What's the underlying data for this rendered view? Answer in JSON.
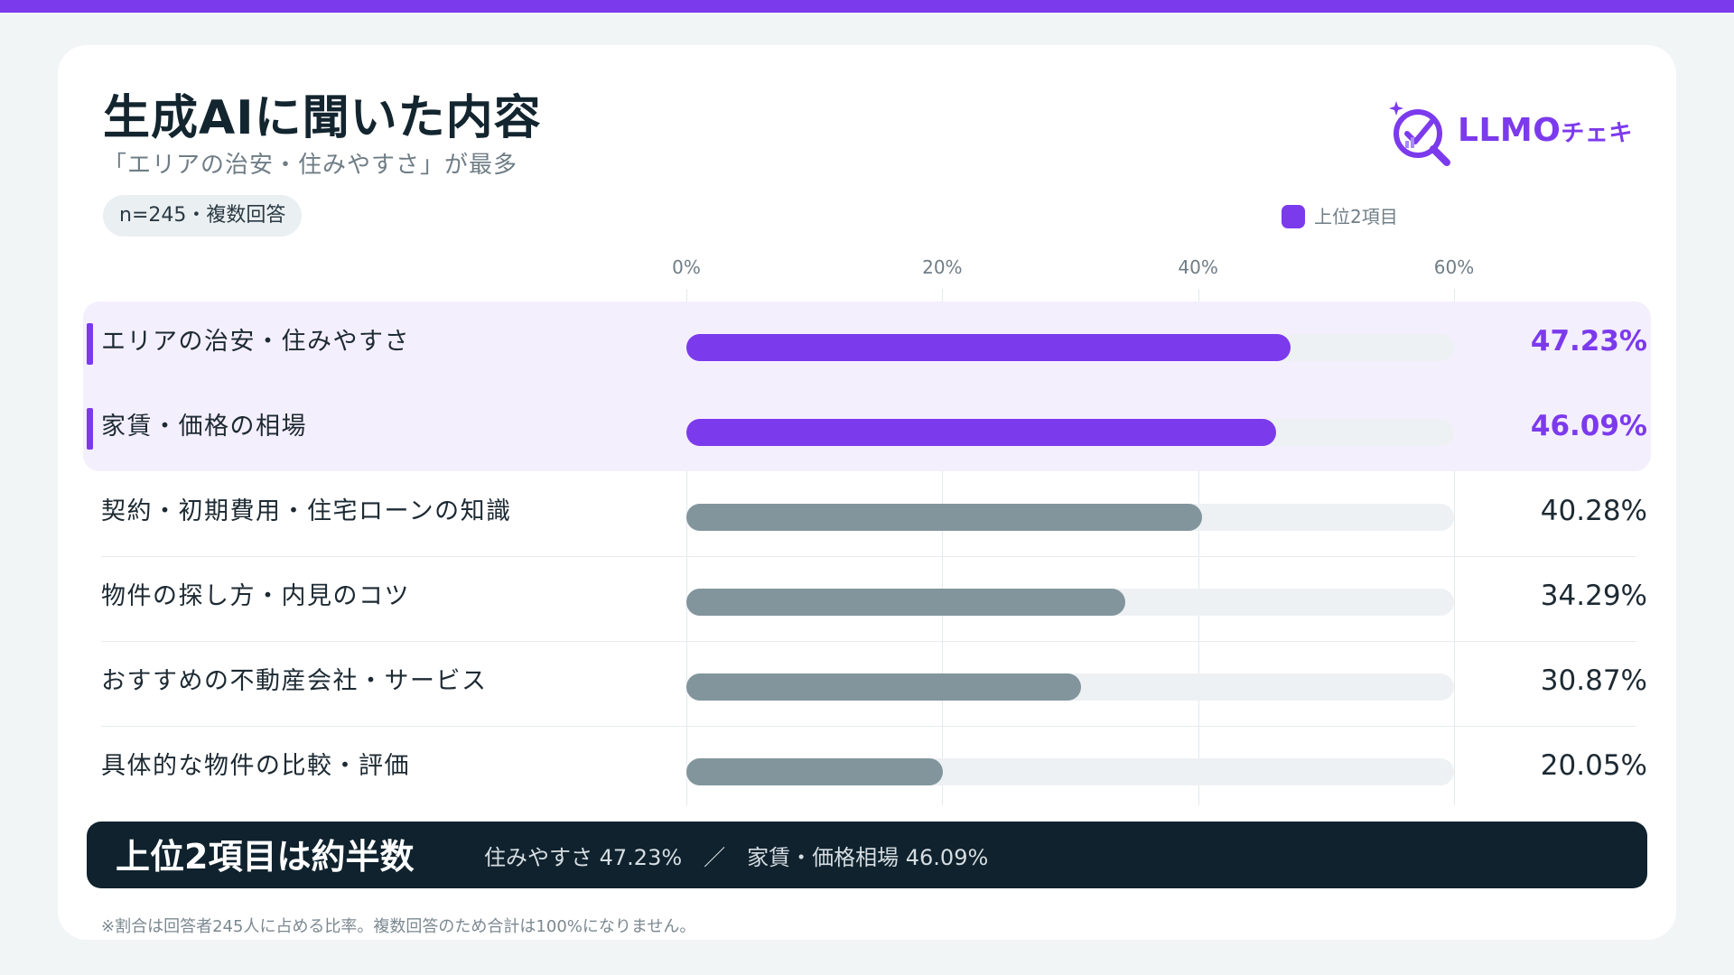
{
  "header": {
    "title": "生成AIに聞いた内容",
    "subtitle": "「エリアの治安・住みやすさ」が最多",
    "sample_note": "n=245・複数回答"
  },
  "logo": {
    "text_latin": "LLMO",
    "text_kana": "チェキ"
  },
  "legend": {
    "label": "上位2項目"
  },
  "summary": {
    "headline": "上位2項目は約半数",
    "detail": "住みやすさ 47.23%　／　家賃・価格相場 46.09%"
  },
  "footnote": "※割合は回答者245人に占める比率。複数回答のため合計は100%になりません。",
  "colors": {
    "accent": "#7c3aed",
    "bar_other": "#82959d",
    "track": "#eef1f3",
    "banner": "#0f222e"
  },
  "chart_data": {
    "type": "bar",
    "orientation": "horizontal",
    "categories": [
      "エリアの治安・住みやすさ",
      "家賃・価格の相場",
      "契約・初期費用・住宅ローンの知識",
      "物件の探し方・内見のコツ",
      "おすすめの不動産会社・サービス",
      "具体的な物件の比較・評価"
    ],
    "values": [
      47.23,
      46.09,
      40.28,
      34.29,
      30.87,
      20.05
    ],
    "value_labels": [
      "47.23%",
      "46.09%",
      "40.28%",
      "34.29%",
      "30.87%",
      "20.05%"
    ],
    "highlighted_count": 2,
    "xlim": [
      0,
      60
    ],
    "x_ticks": [
      "0%",
      "20%",
      "40%",
      "60%"
    ],
    "grid": true,
    "legend_position": "top-right"
  }
}
